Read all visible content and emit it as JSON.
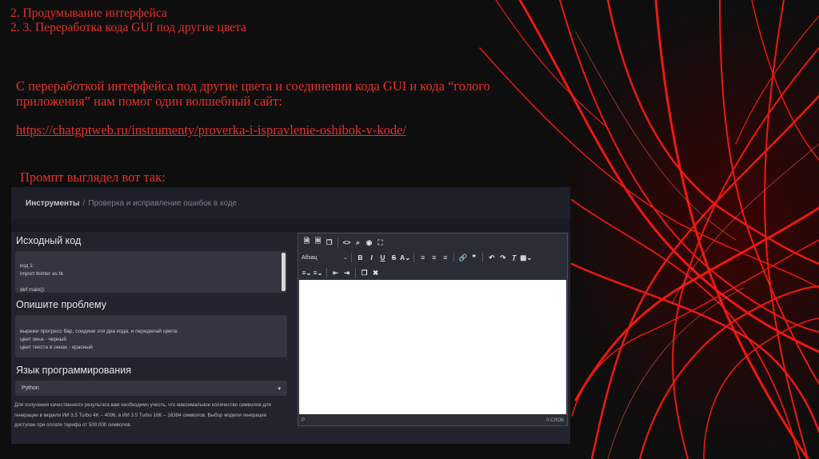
{
  "slide": {
    "title_line1": "2. Продумывание интерфейса",
    "title_line2": "2. 3. Переработка кода GUI под другие цвета",
    "intro_text": "С переработкой интерфейса под  другие цвета и соединении кода GUI и  кода “голого приложения” нам помог один волшебный сайт:",
    "link_url": "https://chatgptweb.ru/instrumenty/proverka-i-ispravlenie-oshibok-v-kode/",
    "prompt_caption": "Промпт выглядел вот так:"
  },
  "screenshot": {
    "breadcrumb": {
      "root": "Инструменты",
      "separator": "/",
      "current": "Проверка и исправление ошибок в коде"
    },
    "source_code": {
      "label": "Исходный код",
      "value": "код 1:\nimport tkinter as tk\n\ndef main():\n    # Создаем основное окно"
    },
    "problem": {
      "label": "Опишите проблему",
      "value": "вырежи прогресс бар, соедини эти два кода, и переделай цвета:\nцвет окна - черный\nцвет текста в окнах - красный"
    },
    "language": {
      "label": "Язык программирования",
      "selected": "Python"
    },
    "notice": "Для получения качественного результата вам необходимо учесть, что максимальное количество символов для генерации в модели ИИ 3.5 Turbo 4K – 4096, в ИИ 3.5 Turbo 16K – 16384 символов. Выбор модели генерации доступен при оплате тарифа от 500.000 символов.",
    "editor": {
      "paragraph_select": "Абзац",
      "status_path": "P",
      "word_count": "0 СЛОВ"
    }
  },
  "colors": {
    "accent_red": "#e8302a",
    "page_bg": "#0e0e0e",
    "panel_bg": "#22242d"
  }
}
